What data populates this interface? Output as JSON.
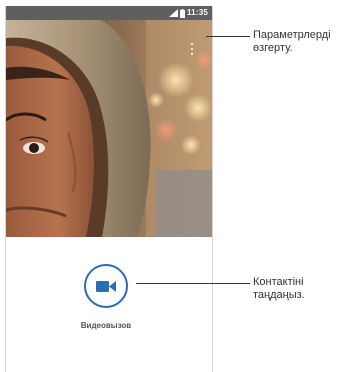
{
  "status_bar": {
    "time": "11:35",
    "signal_icon": "signal-icon",
    "battery_icon": "battery-icon",
    "background_color": "#5f5f5f"
  },
  "toolbar": {
    "overflow_icon": "overflow-menu-icon"
  },
  "call_panel": {
    "video_call_label": "Видеовызов",
    "video_call_icon": "video-camera-icon",
    "accent_color": "#2b6cb2"
  },
  "callouts": {
    "settings_line1": "Параметрлерді",
    "settings_line2": "өзгерту.",
    "contact_line1": "Контактіні",
    "contact_line2": "таңдаңыз."
  }
}
